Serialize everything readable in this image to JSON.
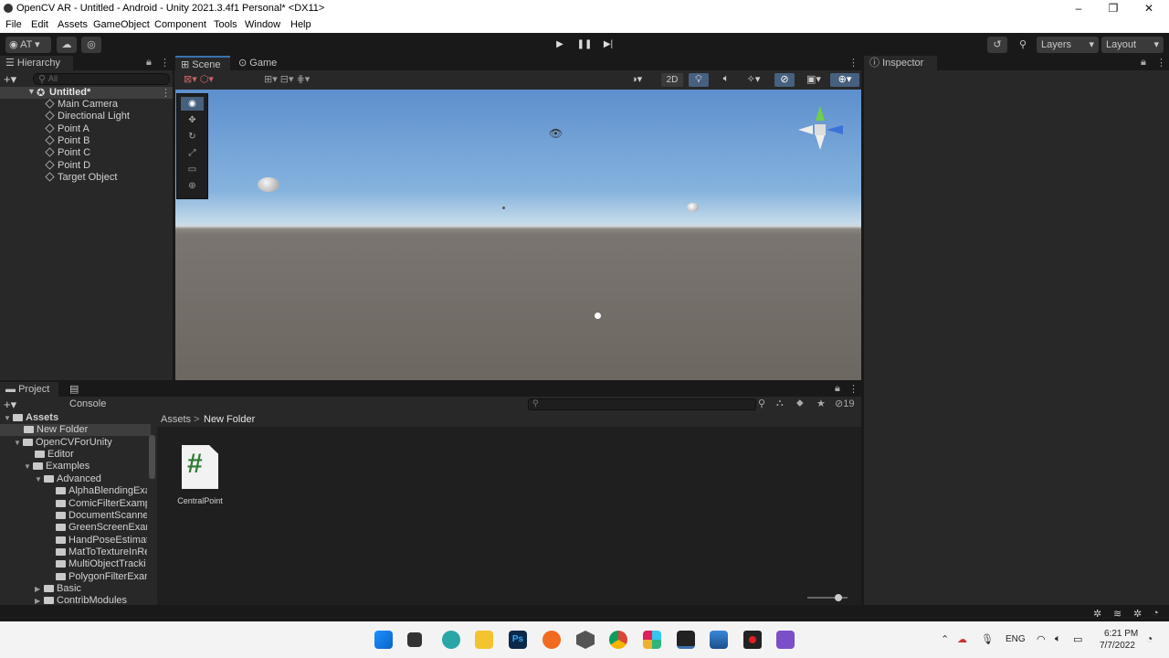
{
  "window": {
    "title": "OpenCV AR - Untitled - Android - Unity 2021.3.4f1 Personal* <DX11>",
    "minimize": "–",
    "maximize": "❐",
    "close": "✕"
  },
  "menu": [
    "File",
    "Edit",
    "Assets",
    "GameObject",
    "Component",
    "Tools",
    "Window",
    "Help"
  ],
  "toolbar": {
    "account": "AT",
    "layers": "Layers",
    "layout": "Layout"
  },
  "hierarchy": {
    "tab": "Hierarchy",
    "search_placeholder": "All",
    "scene": "Untitled*",
    "items": [
      "Main Camera",
      "Directional Light",
      "Point A",
      "Point B",
      "Point C",
      "Point D",
      "Target Object"
    ]
  },
  "scene": {
    "tab_scene": "Scene",
    "tab_game": "Game",
    "mode_2d": "2D"
  },
  "inspector": {
    "tab": "Inspector"
  },
  "project": {
    "tab_project": "Project",
    "tab_console": "Console",
    "hidden_count": "19",
    "breadcrumb": [
      "Assets",
      "New Folder"
    ],
    "tree": [
      "Assets",
      "New Folder",
      "OpenCVForUnity",
      "Editor",
      "Examples",
      "Advanced",
      "AlphaBlendingExa",
      "ComicFilterExamp",
      "DocumentScanne",
      "GreenScreenExan",
      "HandPoseEstimat",
      "MatToTextureInRe",
      "MultiObjectTracki",
      "PolygonFilterExan",
      "Basic",
      "ContribModules"
    ],
    "asset": {
      "name": "CentralPoint",
      "glyph": "#"
    }
  },
  "taskbar": {
    "lang": "ENG",
    "time": "6:21 PM",
    "date": "7/7/2022"
  },
  "colors": {
    "accent": "#3a72b0",
    "editor_bg": "#282828"
  }
}
